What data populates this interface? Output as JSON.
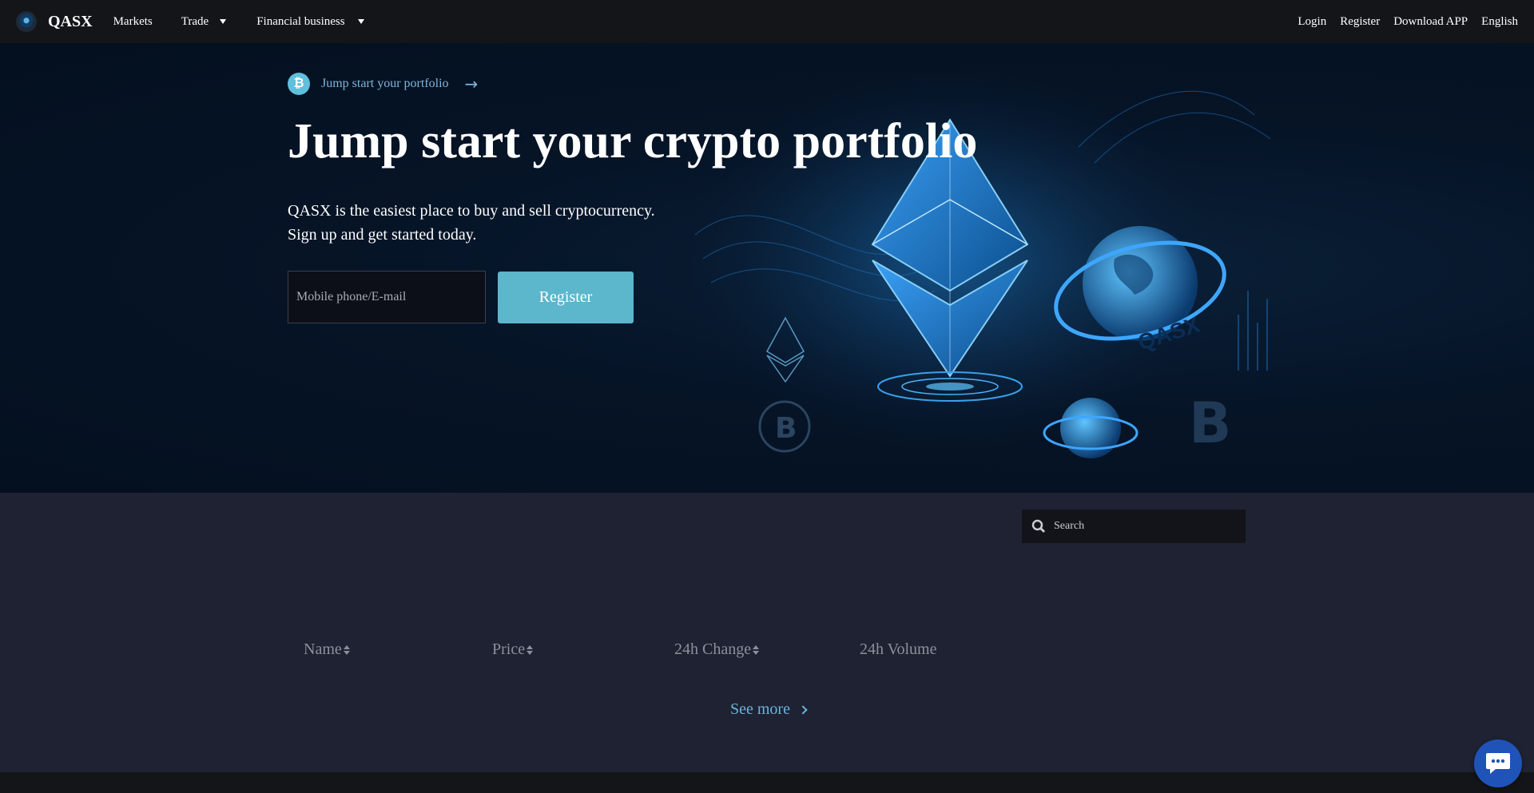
{
  "nav": {
    "brand": "QASX",
    "items": [
      {
        "label": "Markets"
      },
      {
        "label": "Trade"
      },
      {
        "label": "Financial business"
      }
    ],
    "right": {
      "login": "Login",
      "register": "Register",
      "download": "Download APP",
      "language": "English"
    }
  },
  "hero": {
    "breadcrumb": "Jump start your portfolio",
    "headline": "Jump start your crypto portfolio",
    "subtitle_line1": "QASX is the easiest place to buy and sell cryptocurrency.",
    "subtitle_line2": "Sign up and get started today.",
    "input_placeholder": "Mobile phone/E-mail",
    "register_button": "Register",
    "art_label": "QASX"
  },
  "market": {
    "search_placeholder": "Search",
    "columns": [
      "Name",
      "Price",
      "24h Change",
      "24h Volume"
    ],
    "see_more": "See more"
  },
  "colors": {
    "accent": "#5cb6cc",
    "link": "#6cb3dc",
    "chat": "#1f53b8"
  }
}
